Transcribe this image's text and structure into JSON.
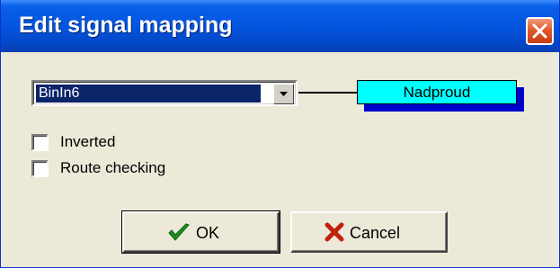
{
  "window": {
    "title": "Edit signal mapping",
    "close_icon": "close-icon"
  },
  "signal": {
    "selected_input": "BinIn6",
    "target_name": "Nadproud",
    "target_color": "#00ffff",
    "target_shadow_color": "#0000cc"
  },
  "options": {
    "inverted_label": "Inverted",
    "inverted_checked": false,
    "route_checking_label": "Route checking",
    "route_checking_checked": false
  },
  "buttons": {
    "ok_label": "OK",
    "ok_icon": "checkmark-icon",
    "cancel_label": "Cancel",
    "cancel_icon": "x-icon"
  },
  "colors": {
    "title_bar": "#0455e0",
    "dialog_bg": "#ece9d8",
    "close_button": "#e05a2c",
    "ok_icon": "#1f8f1f",
    "cancel_icon": "#c0200e"
  }
}
